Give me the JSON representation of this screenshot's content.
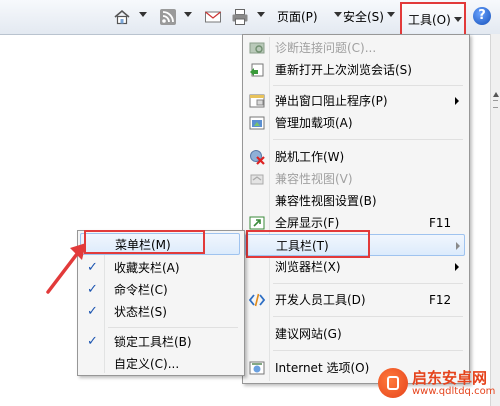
{
  "toolbar": {
    "page_label": "页面(P)",
    "safety_label": "安全(S)",
    "tools_label": "工具(O)",
    "help_glyph": "?"
  },
  "tools_menu": {
    "items": [
      {
        "label": "诊断连接问题(C)...",
        "disabled": true,
        "icon": "network-diagnose-icon"
      },
      {
        "label": "重新打开上次浏览会话(S)",
        "icon": "reopen-session-icon"
      },
      {
        "label": "弹出窗口阻止程序(P)",
        "submenu": true,
        "icon": "popup-blocker-icon"
      },
      {
        "label": "管理加载项(A)",
        "icon": "addons-icon"
      },
      {
        "label": "脱机工作(W)",
        "icon": "offline-icon"
      },
      {
        "label": "兼容性视图(V)",
        "disabled": true,
        "icon": "compat-view-icon"
      },
      {
        "label": "兼容性视图设置(B)"
      },
      {
        "label": "全屏显示(F)",
        "accelerator": "F11",
        "icon": "fullscreen-icon"
      },
      {
        "label": "工具栏(T)",
        "submenu": true,
        "highlighted": true
      },
      {
        "label": "浏览器栏(X)",
        "submenu": true
      },
      {
        "label": "开发人员工具(D)",
        "accelerator": "F12",
        "icon": "developer-tools-icon"
      },
      {
        "label": "建议网站(G)"
      },
      {
        "label": "Internet 选项(O)",
        "icon": "internet-options-icon"
      }
    ]
  },
  "toolbars_submenu": {
    "items": [
      {
        "label": "菜单栏(M)",
        "checked": false,
        "highlighted": true
      },
      {
        "label": "收藏夹栏(A)",
        "checked": true
      },
      {
        "label": "命令栏(C)",
        "checked": true
      },
      {
        "label": "状态栏(S)",
        "checked": true
      },
      {
        "label": "锁定工具栏(B)",
        "checked": true
      },
      {
        "label": "自定义(C)...",
        "checked": false
      }
    ],
    "check_glyph": "✓"
  },
  "watermark": {
    "title": "启东安卓网",
    "url": "www.qdltdq.com"
  },
  "colors": {
    "annotation_red": "#e23a3a",
    "highlight_blue": "#dcebfc",
    "check_blue": "#1b54b0"
  }
}
